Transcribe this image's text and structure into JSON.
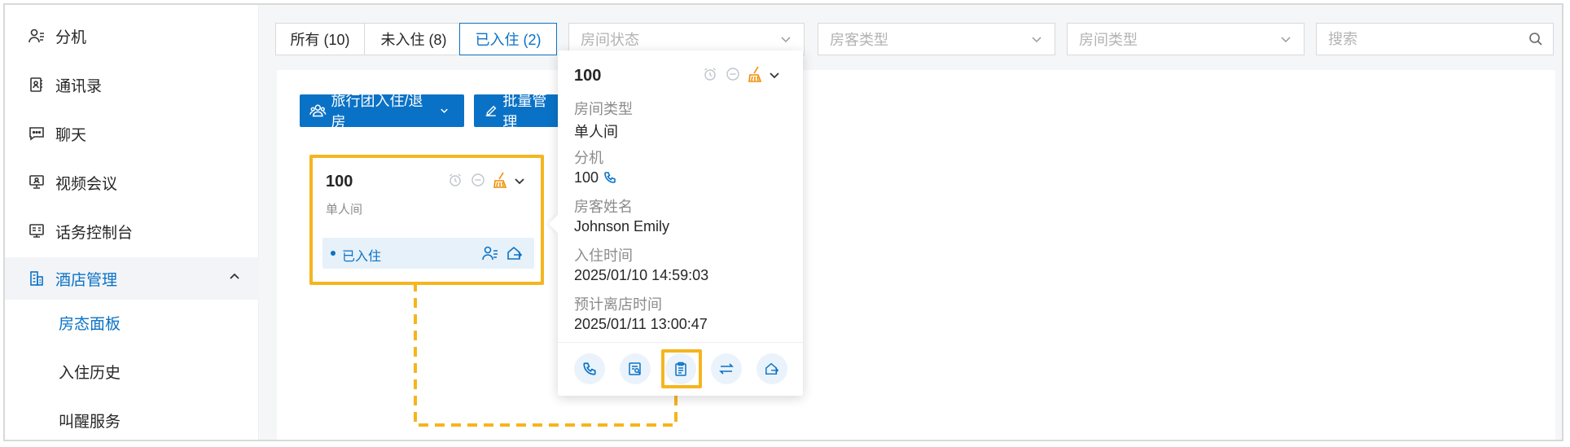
{
  "sidebar": {
    "items": [
      {
        "label": "分机",
        "icon": "user-list-icon"
      },
      {
        "label": "通讯录",
        "icon": "contacts-book-icon"
      },
      {
        "label": "聊天",
        "icon": "chat-icon"
      },
      {
        "label": "视频会议",
        "icon": "video-conference-icon"
      },
      {
        "label": "话务控制台",
        "icon": "operator-console-icon"
      },
      {
        "label": "酒店管理",
        "icon": "hotel-building-icon",
        "expanded": true
      }
    ],
    "sub_items": [
      {
        "label": "房态面板",
        "selected": true
      },
      {
        "label": "入住历史"
      },
      {
        "label": "叫醒服务"
      }
    ]
  },
  "filters": {
    "tabs": [
      {
        "label": "所有 (10)"
      },
      {
        "label": "未入住 (8)"
      },
      {
        "label": "已入住 (2)",
        "active": true
      }
    ],
    "room_status_placeholder": "房间状态",
    "guest_type_placeholder": "房客类型",
    "room_type_placeholder": "房间类型",
    "search_placeholder": "搜索"
  },
  "toolbar": {
    "group_checkin_label": "旅行团入住/退房",
    "batch_manage_label": "批量管理"
  },
  "room_card": {
    "number": "100",
    "type": "单人间",
    "status": "已入住"
  },
  "popover": {
    "number": "100",
    "room_type_label": "房间类型",
    "room_type_value": "单人间",
    "extension_label": "分机",
    "extension_value": "100",
    "guest_name_label": "房客姓名",
    "guest_name_value": "Johnson Emily",
    "checkin_time_label": "入住时间",
    "checkin_time_value": "2025/01/10 14:59:03",
    "checkout_time_label": "预计离店时间",
    "checkout_time_value": "2025/01/11 13:00:47"
  },
  "colors": {
    "brand": "#0a72c6",
    "highlight": "#f5b51f",
    "cleaning": "#f08c00"
  }
}
